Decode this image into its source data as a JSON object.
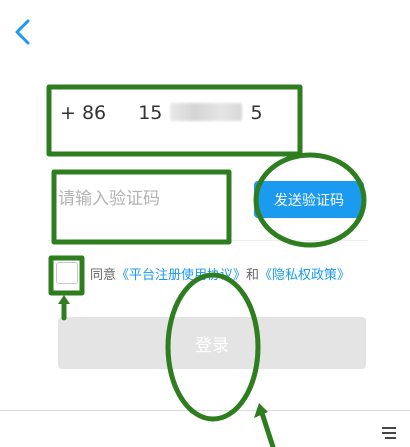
{
  "phone": {
    "country_code": "+ 86",
    "number_prefix": "15",
    "number_suffix": "5"
  },
  "code_input": {
    "placeholder": "请输入验证码"
  },
  "send_code_label": "发送验证码",
  "agreement": {
    "prefix": "同意",
    "platform_link": "《平台注册使用协议》",
    "and": "和",
    "privacy_link": "《隐私权政策》"
  },
  "login_label": "登录",
  "colors": {
    "accent": "#1a9bf0",
    "annotation": "#2e7d1e",
    "login_disabled": "#e4e4e4"
  },
  "icons": {
    "back": "chevron-left-icon",
    "menu": "menu-icon"
  }
}
